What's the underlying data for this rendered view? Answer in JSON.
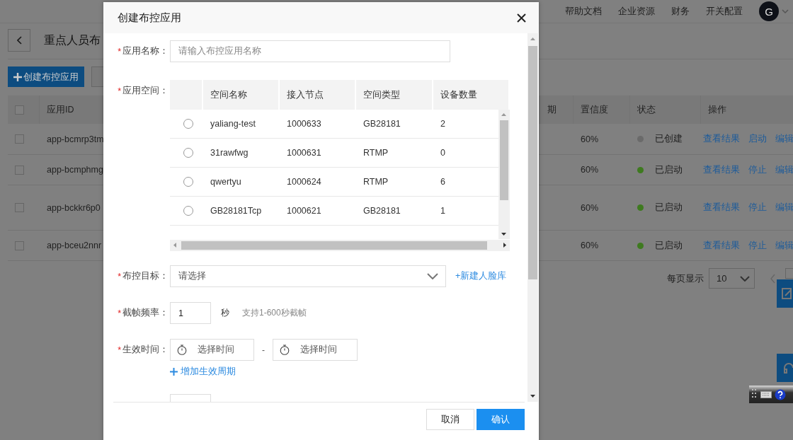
{
  "top_nav": {
    "items": [
      "帮助文档",
      "企业资源",
      "财务",
      "开关配置"
    ],
    "avatar": "G"
  },
  "page": {
    "title": "重点人员布",
    "create_button": "创建布控应用"
  },
  "table": {
    "columns": [
      "应用ID",
      "期",
      "置信度",
      "状态",
      "操作"
    ],
    "header_checked": false,
    "rows": [
      {
        "checked": false,
        "id": "app-bcmrp3tm",
        "confidence": "60%",
        "status": "已创建",
        "color": "#6a6a6a",
        "actions": [
          "查看结果",
          "启动",
          "编辑"
        ]
      },
      {
        "checked": false,
        "id": "app-bcmphmg",
        "confidence": "60%",
        "status": "已启动",
        "color": "#3e7a1f",
        "actions": [
          "查看结果",
          "停止",
          "编辑"
        ]
      },
      {
        "checked": false,
        "id": "app-bckkr6p0",
        "confidence": "60%",
        "status": "已启动",
        "color": "#3e7a1f",
        "actions": [
          "查看结果",
          "停止",
          "编辑"
        ]
      },
      {
        "checked": false,
        "id": "app-bceu2nnr",
        "confidence": "60%",
        "status": "已启动",
        "color": "#3e7a1f",
        "actions": [
          "查看结果",
          "停止",
          "编辑"
        ]
      }
    ]
  },
  "pagination": {
    "label": "每页显示",
    "page_size": "10"
  },
  "dialog": {
    "title": "创建布控应用",
    "name_field": {
      "required_mark": "*",
      "label": "应用名称：",
      "placeholder": "请输入布控应用名称"
    },
    "space_field": {
      "required_mark": "*",
      "label": "应用空间：",
      "columns": [
        "空间名称",
        "接入节点",
        "空间类型",
        "设备数量"
      ],
      "rows": [
        {
          "selected": false,
          "name": "yaliang-test",
          "node": "1000633",
          "type": "GB28181",
          "devices": "2"
        },
        {
          "selected": false,
          "name": "31rawfwg",
          "node": "1000631",
          "type": "RTMP",
          "devices": "0"
        },
        {
          "selected": false,
          "name": "qwertyu",
          "node": "1000624",
          "type": "RTMP",
          "devices": "6"
        },
        {
          "selected": false,
          "name": "GB28181Tcp",
          "node": "1000621",
          "type": "GB28181",
          "devices": "1"
        }
      ]
    },
    "target_field": {
      "required_mark": "*",
      "label": "布控目标：",
      "placeholder": "请选择",
      "link": "+新建人脸库"
    },
    "frame_field": {
      "required_mark": "*",
      "label": "截帧频率：",
      "value": "1",
      "unit": "秒",
      "hint": "支持1-600秒截帧"
    },
    "time_field": {
      "required_mark": "*",
      "label": "生效时间：",
      "start_placeholder": "选择时间",
      "separator": "-",
      "end_placeholder": "选择时间",
      "add_link": "增加生效周期"
    },
    "buttons": [
      {
        "label": "取消",
        "kind": "secondary"
      },
      {
        "label": "确认",
        "kind": "primary"
      }
    ]
  }
}
